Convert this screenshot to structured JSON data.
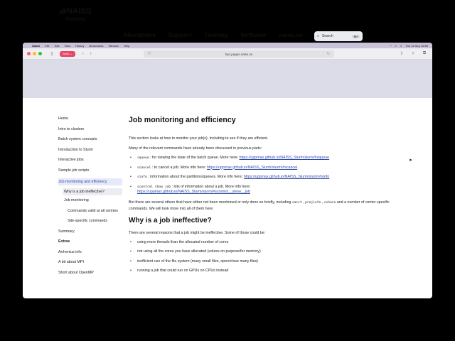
{
  "menubar": {
    "app": "Safari",
    "items": [
      "File",
      "Edit",
      "View",
      "History",
      "Bookmarks",
      "Window",
      "Help"
    ],
    "datetime": "Tue 15 Sep 16:55"
  },
  "browser": {
    "profile": "Work",
    "url": "hpc.pages.naiss.se"
  },
  "site": {
    "logo": "NAISS",
    "logo_sub": "Training",
    "nav": [
      "Allocations",
      "Support",
      "Training",
      "Software",
      "naiss.se"
    ],
    "search_placeholder": "Search",
    "search_shortcut": "⌘K"
  },
  "sidebar": {
    "items": [
      "Home",
      "Intro to clusters",
      "Batch system concepts",
      "Introduction to Slurm",
      "Interactive jobs",
      "Sample job scripts"
    ],
    "active": "Job monitoring and efficiency",
    "subitems": [
      "Why is a job ineffective?",
      "Job monitoring"
    ],
    "subsubitems": [
      "Commands valid at all centres",
      "Site-specific commands"
    ],
    "summary": "Summary",
    "extras_title": "Extras",
    "extras": [
      "Arrhenius info",
      "A bit about MPI",
      "Short about OpenMP"
    ]
  },
  "content": {
    "title": "Job monitoring and efficiency",
    "intro1": "This section looks at how to monitor your job(s), including to see if they are efficient.",
    "intro2": "Many of the relevant commands have already been discussed in previous parts:",
    "cmds": [
      {
        "code": "squeue",
        "text": " : for viewing the state of the batch queue. More here: ",
        "link": "https://uppmax.github.io/NAISS_Slurm/slurm/#squeue"
      },
      {
        "code": "scancel",
        "text": " : to cancel a job. More info here: ",
        "link": "https://uppmax.github.io/NAISS_Slurm/slurm/#scancel"
      },
      {
        "code": "sinfo",
        "text": " : information about the partitions/queues. More info here: ",
        "link": "https://uppmax.github.io/NAISS_Slurm/slurm/#sinfo"
      },
      {
        "code": "scontrol show job",
        "text": " : lots of information about a job. More info here:",
        "link": "https://uppmax.github.io/NAISS_Slurm/slurm/#scontrol__show__job"
      }
    ],
    "para3_a": "But there are several others that have either not been mentioned or only done so briefly, including ",
    "para3_c1": "sacct",
    "para3_sep1": " , ",
    "para3_c2": "projinfo",
    "para3_sep2": " , ",
    "para3_c3": "sshare",
    "para3_b": " and a number of center specific commands. We will look more into all of them here.",
    "h2": "Why is a job ineffective?",
    "reasons_intro": "There are several reasons that a job might be ineffective. Some of those could be:",
    "reasons": [
      "using more threads than the allocated number of cores",
      "not using all the cores you have allocated (unless on purpose/for memory)",
      "inefficient use of the file system (many small files, open/close many files)",
      "running a job that could run on GPUs on CPUs instead"
    ]
  }
}
